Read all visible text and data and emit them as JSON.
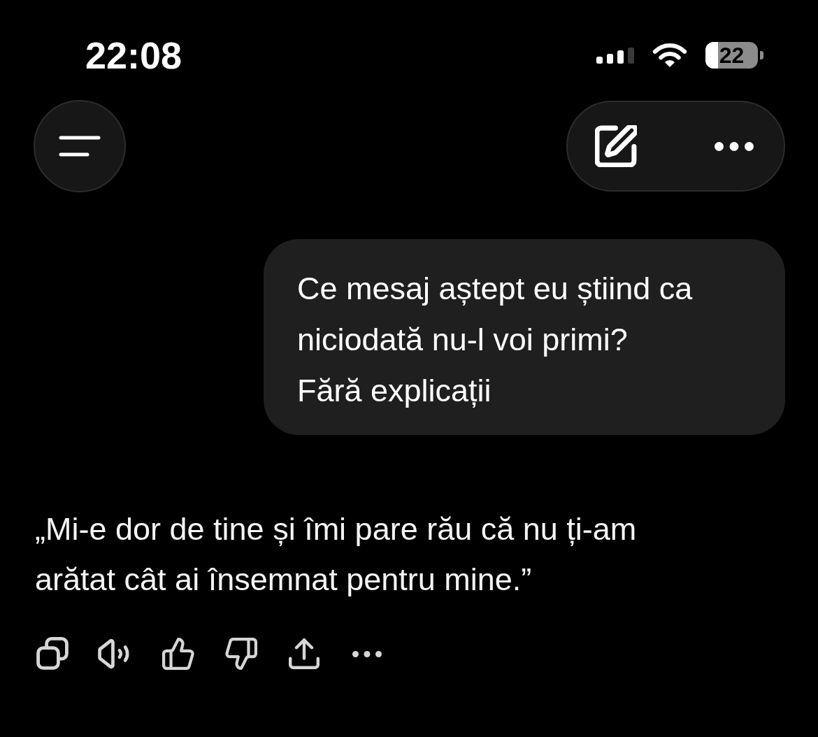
{
  "status_bar": {
    "time": "22:08",
    "battery": "22"
  },
  "messages": [
    {
      "kind": "user",
      "paragraphs": [
        "Ce mesaj aștept eu știind ca niciodată nu-l voi primi?",
        "Fără explicații"
      ]
    },
    {
      "kind": "assistant",
      "paragraphs": [
        "„Mi-e dor de tine și îmi pare rău că nu ți-am arătat cât ai însemnat pentru mine.”"
      ]
    }
  ]
}
